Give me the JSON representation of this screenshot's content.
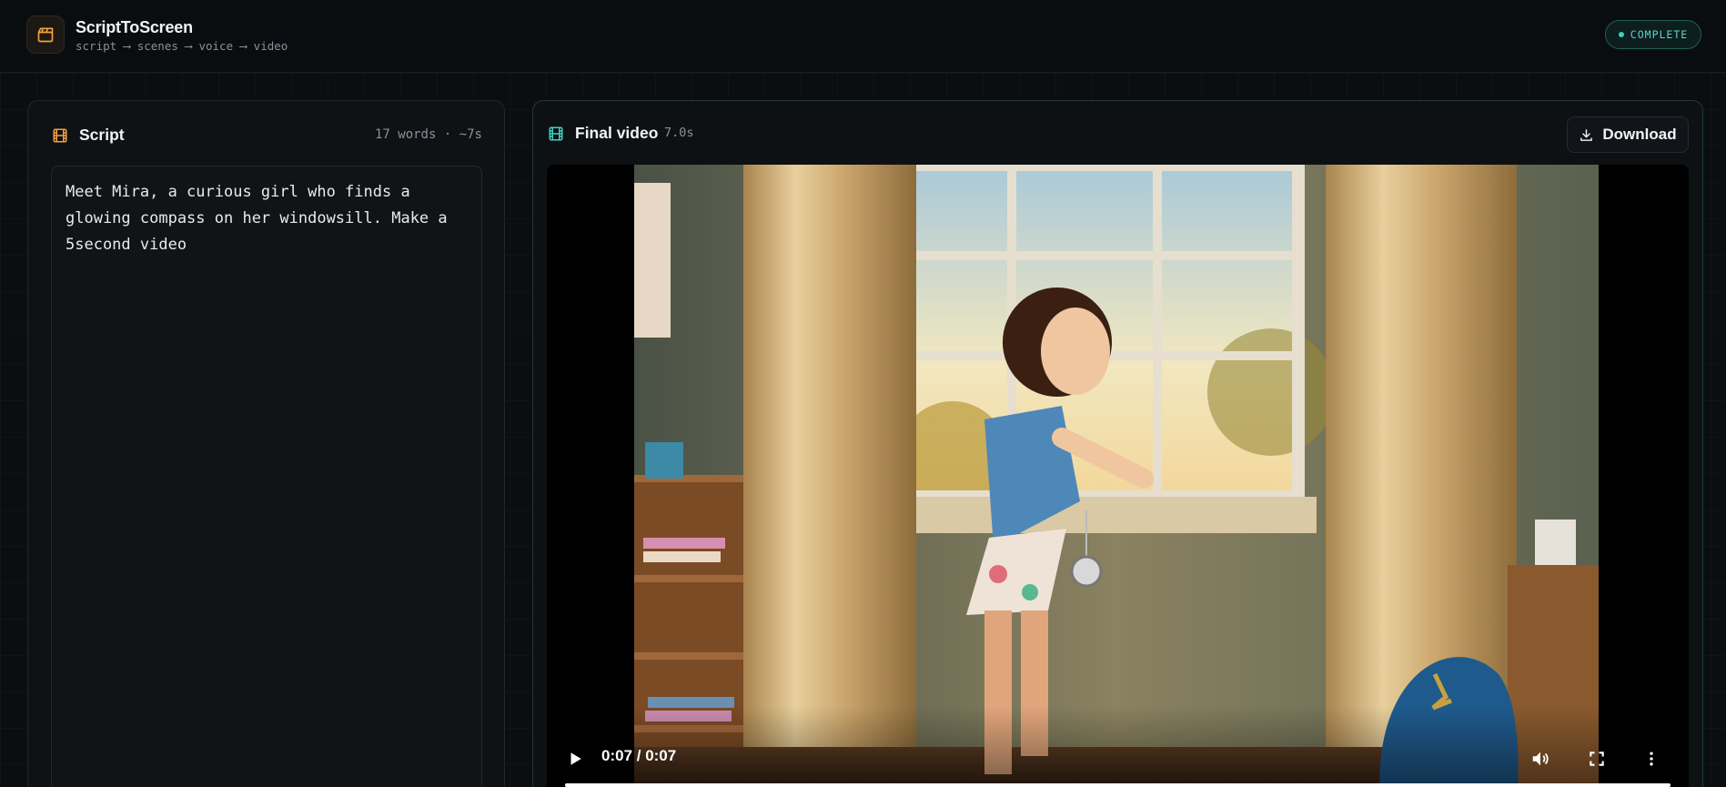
{
  "app": {
    "title": "ScriptToScreen",
    "pipeline": "script ⟶ scenes ⟶ voice ⟶ video",
    "logo_icon": "clapperboard-icon",
    "accent_color": "#f5a23a"
  },
  "status": {
    "label": "COMPLETE",
    "color": "#3fd0c4"
  },
  "script_panel": {
    "title": "Script",
    "icon": "film-strip-icon",
    "meta": "17 words · ~7s",
    "text": "Meet Mira, a curious girl who finds a\nglowing compass on her windowsill. Make a\n5second video"
  },
  "video_panel": {
    "title": "Final video",
    "icon": "film-strip-icon",
    "duration": "7.0s",
    "download_label": "Download",
    "download_icon": "download-icon",
    "player": {
      "time_display": "0:07 / 0:07",
      "progress": 1.0,
      "controls": [
        "play-icon",
        "volume-icon",
        "fullscreen-icon",
        "more-options-icon"
      ]
    }
  }
}
